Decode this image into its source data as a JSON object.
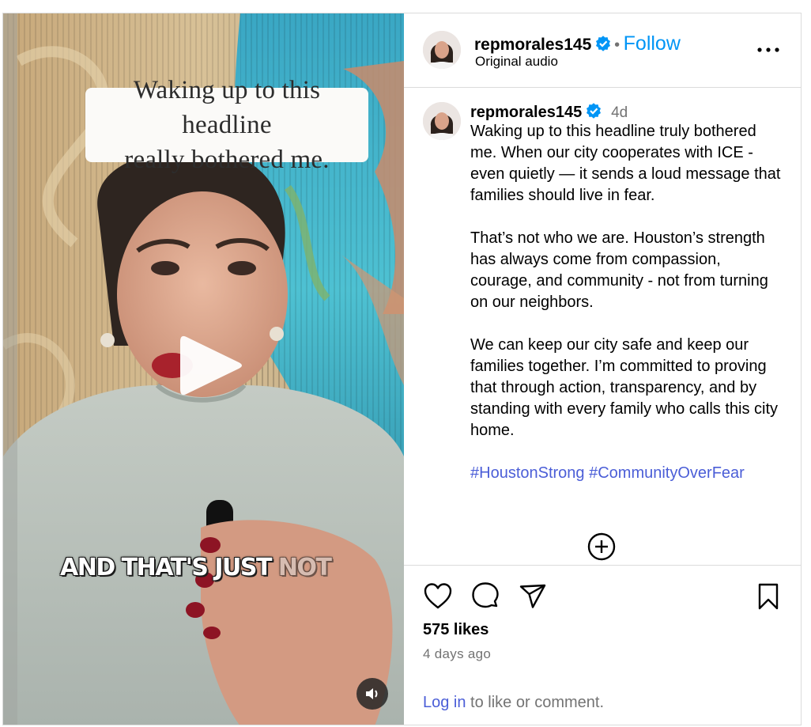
{
  "video": {
    "headline_overlay": "Waking up to this headline\nreally bothered me.",
    "subtitle_bright": "AND THAT'S JUST",
    "subtitle_faded": "NOT"
  },
  "header": {
    "username": "repmorales145",
    "separator": "•",
    "follow_label": "Follow",
    "audio_label": "Original audio"
  },
  "caption": {
    "username": "repmorales145",
    "time": "4d",
    "paragraphs": [
      "Waking up to this headline truly bothered me. When our city cooperates with ICE - even quietly — it sends a loud message that families should live in fear.",
      "That’s not who we are. Houston’s strength has always come from compassion, courage, and community - not from turning on our neighbors.",
      "We can keep our city safe and keep our families together. I’m committed to proving that through action, transparency, and by standing with every family who calls this city home."
    ],
    "hashtags": [
      "#HoustonStrong",
      "#CommunityOverFear"
    ]
  },
  "footer": {
    "likes": "575 likes",
    "posted": "4 days ago",
    "login_link": "Log in",
    "login_suffix": " to like or comment."
  },
  "colors": {
    "link": "#4b5ed7",
    "follow": "#0095f6",
    "verified": "#0095f6",
    "muted": "#737373",
    "border": "#dbdbdb"
  },
  "icons": [
    "verified-badge-icon",
    "more-options-icon",
    "add-comment-icon",
    "heart-icon",
    "comment-icon",
    "share-icon",
    "bookmark-icon",
    "play-icon",
    "audio-icon"
  ]
}
